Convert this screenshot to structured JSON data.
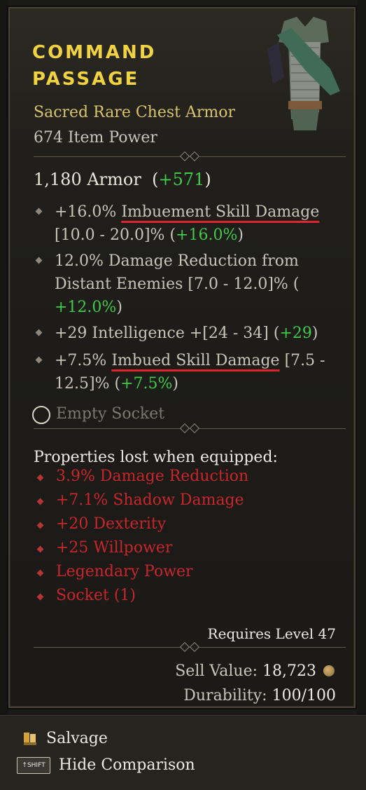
{
  "item": {
    "name_line1": "COMMAND",
    "name_line2": "PASSAGE",
    "type": "Sacred Rare Chest Armor",
    "item_power": "674 Item Power",
    "armor_value": "1,180 Armor",
    "armor_diff": "+571"
  },
  "affixes": [
    {
      "pre": "+16.0% ",
      "highlight": "Imbuement Skill Damage",
      "post1": " ",
      "range": "[10.0 - 20.0]% (",
      "gain": "+16.0%",
      "close": ")"
    },
    {
      "line1": "12.0% Damage Reduction from",
      "line2": "Distant Enemies [7.0 - 12.0]% (",
      "gain": "+12.0%",
      "close": ")"
    },
    {
      "pre": "+29 Intelligence +[24 - 34] (",
      "gain": "+29",
      "close": ")"
    },
    {
      "pre": "+7.5% ",
      "highlight": "Imbued Skill Damage",
      "post1": " [7.5 -",
      "line2": "12.5]% (",
      "gain": "+7.5%",
      "close": ")"
    }
  ],
  "socket": {
    "label": "Empty Socket"
  },
  "lost": {
    "heading": "Properties lost when equipped:",
    "items": [
      "3.9% Damage Reduction",
      "+7.1% Shadow Damage",
      "+20 Dexterity",
      "+25 Willpower",
      "Legendary Power",
      "Socket (1)"
    ]
  },
  "requirements": "Requires Level 47",
  "sell": {
    "label": "Sell Value: ",
    "value": "18,723"
  },
  "durability": {
    "label": "Durability: ",
    "value": "100/100"
  },
  "actions": {
    "salvage": "Salvage",
    "shift_key": "SHIFT",
    "hide": "Hide Comparison"
  },
  "colors": {
    "title": "#f1d342",
    "rare": "#d9c46a",
    "gain": "#41c94a",
    "lost": "#c8262a",
    "underline": "#e0242b"
  },
  "icons": [
    "chest-armor-icon",
    "socket-icon",
    "gold-coin-icon",
    "salvage-icon",
    "shift-key-icon"
  ]
}
